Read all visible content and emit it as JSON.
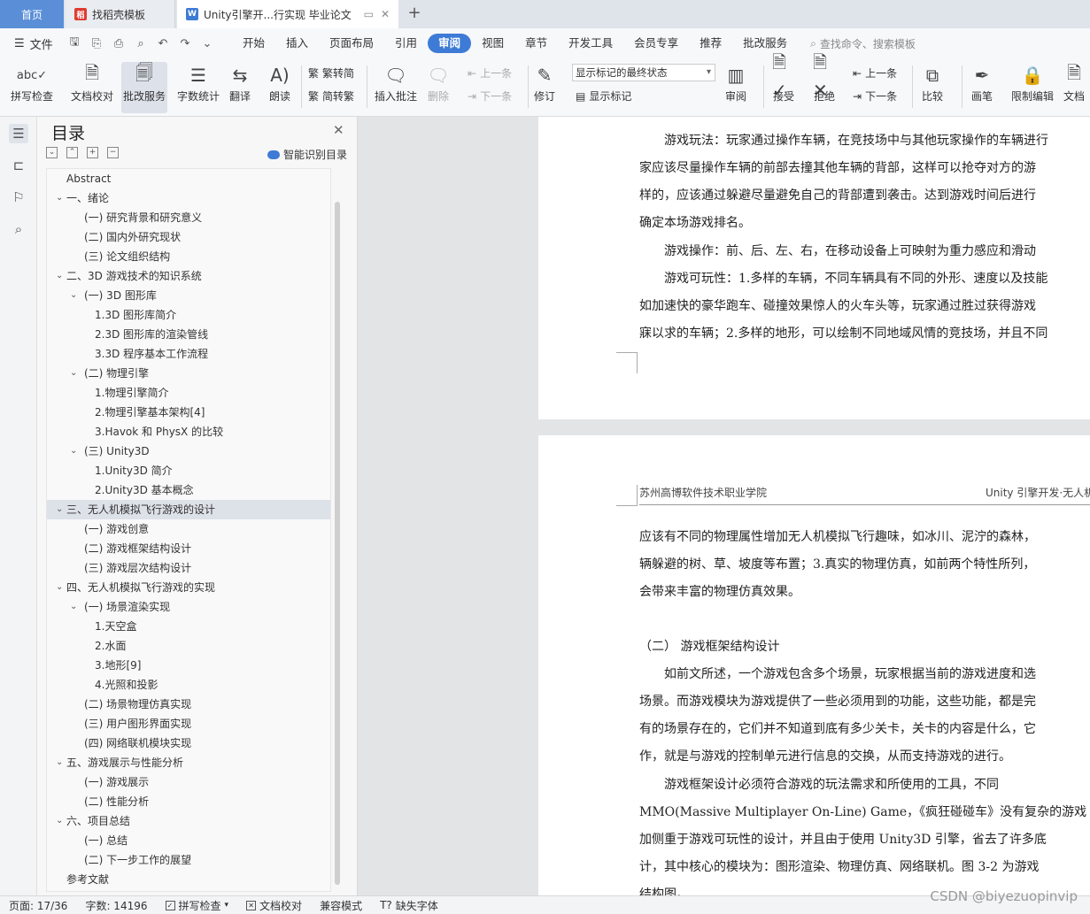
{
  "tabs": {
    "home": "首页",
    "templates": "找稻壳模板",
    "doc": "Unity引擎开...行实现 毕业论文",
    "add": "+"
  },
  "menubar": {
    "file": "文件",
    "items": [
      "开始",
      "插入",
      "页面布局",
      "引用",
      "审阅",
      "视图",
      "章节",
      "开发工具",
      "会员专享",
      "推荐",
      "批改服务"
    ],
    "active": "审阅",
    "search": "查找命令、搜索模板"
  },
  "ribbon": {
    "spell": "拼写检查",
    "proof": "文档校对",
    "correction": "批改服务",
    "wordcount": "字数统计",
    "translate": "翻译",
    "read": "朗读",
    "to_trad": "繁转简",
    "to_simp": "简转繁",
    "insert_comment": "插入批注",
    "delete": "删除",
    "prev": "上一条",
    "next": "下一条",
    "revise": "修订",
    "mark_state": "显示标记的最终状态",
    "show_marks": "显示标记",
    "review": "审阅",
    "accept": "接受",
    "reject": "拒绝",
    "prev2": "上一条",
    "next2": "下一条",
    "compare": "比较",
    "pen": "画笔",
    "restrict": "限制编辑",
    "doc_right": "文档"
  },
  "toc": {
    "title": "目录",
    "smart": "智能识别目录",
    "items": [
      {
        "text": "Abstract",
        "level": 0,
        "chev": ""
      },
      {
        "text": "一、绪论",
        "level": 0,
        "chev": "v"
      },
      {
        "text": "(一) 研究背景和研究意义",
        "level": 1,
        "chev": ""
      },
      {
        "text": "(二) 国内外研究现状",
        "level": 1,
        "chev": ""
      },
      {
        "text": "(三) 论文组织结构",
        "level": 1,
        "chev": ""
      },
      {
        "text": "二、3D 游戏技术的知识系统",
        "level": 0,
        "chev": "v"
      },
      {
        "text": "(一) 3D 图形库",
        "level": 1,
        "chev": "v"
      },
      {
        "text": "1.3D 图形库简介",
        "level": 2,
        "chev": ""
      },
      {
        "text": "2.3D 图形库的渲染管线",
        "level": 2,
        "chev": ""
      },
      {
        "text": "3.3D 程序基本工作流程",
        "level": 2,
        "chev": ""
      },
      {
        "text": "(二) 物理引擎",
        "level": 1,
        "chev": "v"
      },
      {
        "text": "1.物理引擎简介",
        "level": 2,
        "chev": ""
      },
      {
        "text": "2.物理引擎基本架构[4]",
        "level": 2,
        "chev": ""
      },
      {
        "text": "3.Havok 和 PhysX 的比较",
        "level": 2,
        "chev": ""
      },
      {
        "text": "(三) Unity3D",
        "level": 1,
        "chev": "v"
      },
      {
        "text": "1.Unity3D 简介",
        "level": 2,
        "chev": ""
      },
      {
        "text": "2.Unity3D 基本概念",
        "level": 2,
        "chev": ""
      },
      {
        "text": "三、无人机模拟飞行游戏的设计",
        "level": 0,
        "chev": "v",
        "selected": true
      },
      {
        "text": "(一) 游戏创意",
        "level": 1,
        "chev": ""
      },
      {
        "text": "(二) 游戏框架结构设计",
        "level": 1,
        "chev": ""
      },
      {
        "text": "(三) 游戏层次结构设计",
        "level": 1,
        "chev": ""
      },
      {
        "text": "四、无人机模拟飞行游戏的实现",
        "level": 0,
        "chev": "v"
      },
      {
        "text": "(一) 场景渲染实现",
        "level": 1,
        "chev": "v"
      },
      {
        "text": "1.天空盒",
        "level": 2,
        "chev": ""
      },
      {
        "text": "2.水面",
        "level": 2,
        "chev": ""
      },
      {
        "text": "3.地形[9]",
        "level": 2,
        "chev": ""
      },
      {
        "text": "4.光照和投影",
        "level": 2,
        "chev": ""
      },
      {
        "text": "(二) 场景物理仿真实现",
        "level": 1,
        "chev": ""
      },
      {
        "text": "(三) 用户图形界面实现",
        "level": 1,
        "chev": ""
      },
      {
        "text": "(四) 网络联机模块实现",
        "level": 1,
        "chev": ""
      },
      {
        "text": "五、游戏展示与性能分析",
        "level": 0,
        "chev": "v"
      },
      {
        "text": "(一) 游戏展示",
        "level": 1,
        "chev": ""
      },
      {
        "text": "(二) 性能分析",
        "level": 1,
        "chev": ""
      },
      {
        "text": "六、项目总结",
        "level": 0,
        "chev": "v"
      },
      {
        "text": "(一) 总结",
        "level": 1,
        "chev": ""
      },
      {
        "text": "(二) 下一步工作的展望",
        "level": 1,
        "chev": ""
      },
      {
        "text": "参考文献",
        "level": 0,
        "chev": ""
      }
    ]
  },
  "page1": {
    "lines": [
      "游戏玩法：玩家通过操作车辆，在竞技场中与其他玩家操作的车辆进行",
      "家应该尽量操作车辆的前部去撞其他车辆的背部，这样可以抢夺对方的游",
      "样的，应该通过躲避尽量避免自己的背部遭到袭击。达到游戏时间后进行",
      "确定本场游戏排名。",
      "游戏操作：前、后、左、右，在移动设备上可映射为重力感应和滑动",
      "游戏可玩性：1.多样的车辆，不同车辆具有不同的外形、速度以及技能",
      "如加速快的豪华跑车、碰撞效果惊人的火车头等，玩家通过胜过获得游戏",
      "寐以求的车辆；2.多样的地形，可以绘制不同地域风情的竞技场，并且不同"
    ]
  },
  "page2": {
    "header_left": "苏州高博软件技术职业学院",
    "header_right": "Unity 引擎开发·无人机",
    "lines": [
      "应该有不同的物理属性增加无人机模拟飞行趣味，如冰川、泥泞的森林，",
      "辆躲避的树、草、坡度等布置；3.真实的物理仿真，如前两个特性所列，",
      "会带来丰富的物理仿真效果。",
      "（二） 游戏框架结构设计",
      "如前文所述，一个游戏包含多个场景，玩家根据当前的游戏进度和选",
      "场景。而游戏模块为游戏提供了一些必须用到的功能，这些功能，都是完",
      "有的场景存在的，它们并不知道到底有多少关卡，关卡的内容是什么，它",
      "作，就是与游戏的控制单元进行信息的交换，从而支持游戏的进行。",
      "游戏框架设计必须符合游戏的玩法需求和所使用的工具，不同",
      "MMO(Massive Multiplayer On-Line) Game，《疯狂碰碰车》没有复杂的游戏",
      "加侧重于游戏可玩性的设计，并且由于使用 Unity3D 引擎，省去了许多底",
      "计，其中核心的模块为：图形渲染、物理仿真、网络联机。图 3-2 为游戏",
      "结构图。"
    ]
  },
  "status": {
    "page": "页面: 17/36",
    "words": "字数: 14196",
    "spell": "拼写检查",
    "proof": "文档校对",
    "compat": "兼容模式",
    "missing_font": "缺失字体"
  },
  "watermark": "CSDN @biyezuopinvip",
  "colors": {
    "accent": "#3e7bd6",
    "home_tab": "#5a8fd8",
    "wps_red": "#e03a2f"
  }
}
